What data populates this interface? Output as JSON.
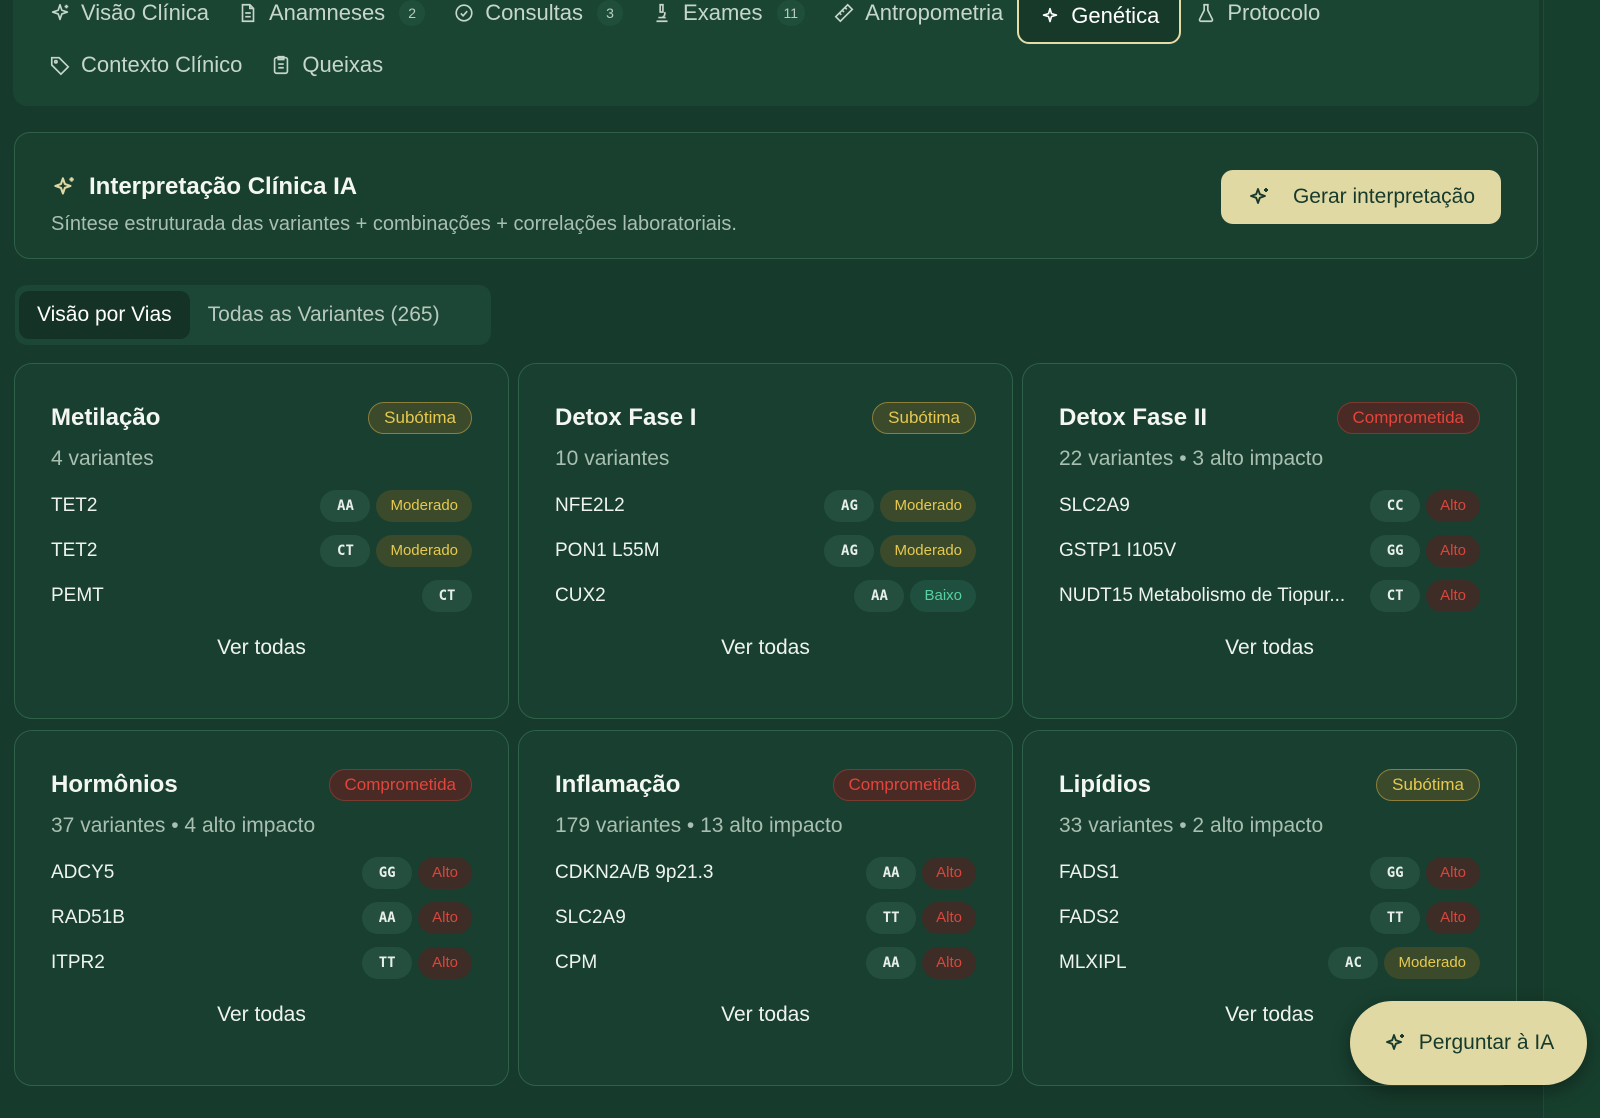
{
  "tabs": [
    {
      "label": "Visão Clínica",
      "icon": "sparkle-icon",
      "count": null,
      "active": false
    },
    {
      "label": "Anamneses",
      "icon": "document-icon",
      "count": "2",
      "active": false
    },
    {
      "label": "Consultas",
      "icon": "check-circle-icon",
      "count": "3",
      "active": false
    },
    {
      "label": "Exames",
      "icon": "microscope-icon",
      "count": "11",
      "active": false
    },
    {
      "label": "Antropometria",
      "icon": "ruler-icon",
      "count": null,
      "active": false
    },
    {
      "label": "Genética",
      "icon": "dna-sparkle-icon",
      "count": null,
      "active": true
    },
    {
      "label": "Protocolo",
      "icon": "flask-icon",
      "count": null,
      "active": false
    },
    {
      "label": "Contexto Clínico",
      "icon": "tag-icon",
      "count": null,
      "active": false
    },
    {
      "label": "Queixas",
      "icon": "clipboard-icon",
      "count": null,
      "active": false
    }
  ],
  "ai_card": {
    "title": "Interpretação Clínica IA",
    "subtitle": "Síntese estruturada das variantes + combinações + correlações laboratoriais.",
    "button_label": "Gerar interpretação"
  },
  "view_switch": {
    "by_pathway": "Visão por Vias",
    "all_variants": "Todas as Variantes (265)"
  },
  "see_all_label": "Ver todas",
  "cards": [
    {
      "title": "Metilação",
      "status": "Subótima",
      "status_kind": "sub",
      "meta": "4 variantes",
      "variants": [
        {
          "gene": "TET2",
          "genotype": "AA",
          "impact": "Moderado",
          "impact_kind": "mod"
        },
        {
          "gene": "TET2",
          "genotype": "CT",
          "impact": "Moderado",
          "impact_kind": "mod"
        },
        {
          "gene": "PEMT",
          "genotype": "CT",
          "impact": null,
          "impact_kind": null
        }
      ]
    },
    {
      "title": "Detox Fase I",
      "status": "Subótima",
      "status_kind": "sub",
      "meta": "10 variantes",
      "variants": [
        {
          "gene": "NFE2L2",
          "genotype": "AG",
          "impact": "Moderado",
          "impact_kind": "mod"
        },
        {
          "gene": "PON1 L55M",
          "genotype": "AG",
          "impact": "Moderado",
          "impact_kind": "mod"
        },
        {
          "gene": "CUX2",
          "genotype": "AA",
          "impact": "Baixo",
          "impact_kind": "baixo"
        }
      ]
    },
    {
      "title": "Detox Fase II",
      "status": "Comprometida",
      "status_kind": "comp",
      "meta": "22 variantes • 3 alto impacto",
      "variants": [
        {
          "gene": "SLC2A9",
          "genotype": "CC",
          "impact": "Alto",
          "impact_kind": "alto"
        },
        {
          "gene": "GSTP1 I105V",
          "genotype": "GG",
          "impact": "Alto",
          "impact_kind": "alto"
        },
        {
          "gene": "NUDT15 Metabolismo de Tiopur...",
          "genotype": "CT",
          "impact": "Alto",
          "impact_kind": "alto"
        }
      ]
    },
    {
      "title": "Hormônios",
      "status": "Comprometida",
      "status_kind": "comp",
      "meta": "37 variantes • 4 alto impacto",
      "variants": [
        {
          "gene": "ADCY5",
          "genotype": "GG",
          "impact": "Alto",
          "impact_kind": "alto"
        },
        {
          "gene": "RAD51B",
          "genotype": "AA",
          "impact": "Alto",
          "impact_kind": "alto"
        },
        {
          "gene": "ITPR2",
          "genotype": "TT",
          "impact": "Alto",
          "impact_kind": "alto"
        }
      ]
    },
    {
      "title": "Inflamação",
      "status": "Comprometida",
      "status_kind": "comp",
      "meta": "179 variantes • 13 alto impacto",
      "variants": [
        {
          "gene": "CDKN2A/B 9p21.3",
          "genotype": "AA",
          "impact": "Alto",
          "impact_kind": "alto"
        },
        {
          "gene": "SLC2A9",
          "genotype": "TT",
          "impact": "Alto",
          "impact_kind": "alto"
        },
        {
          "gene": "CPM",
          "genotype": "AA",
          "impact": "Alto",
          "impact_kind": "alto"
        }
      ]
    },
    {
      "title": "Lipídios",
      "status": "Subótima",
      "status_kind": "sub",
      "meta": "33 variantes • 2 alto impacto",
      "variants": [
        {
          "gene": "FADS1",
          "genotype": "GG",
          "impact": "Alto",
          "impact_kind": "alto"
        },
        {
          "gene": "FADS2",
          "genotype": "TT",
          "impact": "Alto",
          "impact_kind": "alto"
        },
        {
          "gene": "MLXIPL",
          "genotype": "AC",
          "impact": "Moderado",
          "impact_kind": "mod"
        }
      ]
    }
  ],
  "ask_ai": {
    "label": "Perguntar à IA",
    "icon": "sparkle-icon"
  },
  "colors": {
    "background": "#163a2b",
    "accent": "#e1d9a4",
    "status_suboptimal": "#e6c94f",
    "status_compromised": "#e2453b",
    "impact_low": "#56d1a1"
  }
}
